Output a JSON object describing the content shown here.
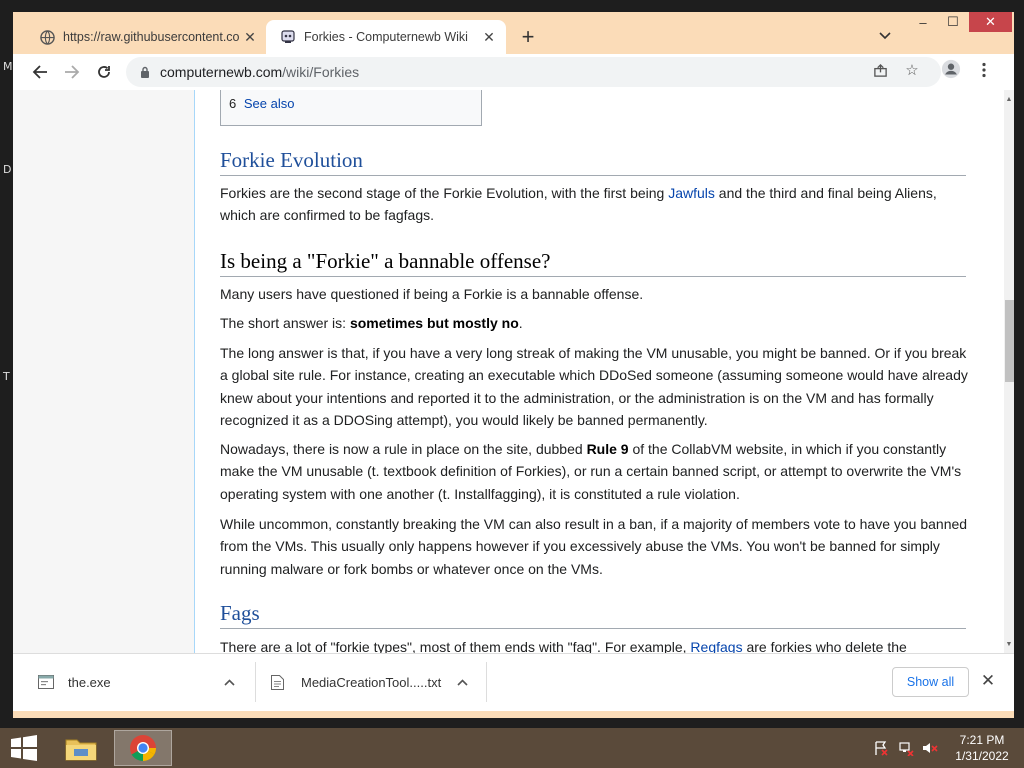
{
  "desktop": {
    "letters": [
      "M",
      "D",
      "T"
    ]
  },
  "tabs": [
    {
      "title": "https://raw.githubusercontent.co"
    },
    {
      "title": "Forkies - Computernewb Wiki"
    }
  ],
  "window": {
    "minimize": "–",
    "maximize": "☐",
    "close": "✕"
  },
  "toolbar": {
    "url_host": "computernewb.com",
    "url_path": "/wiki/Forkies"
  },
  "toc": {
    "number": "6",
    "label": "See also"
  },
  "article": {
    "h_evolution": "Forkie Evolution",
    "p_evolution_1": "Forkies are the second stage of the Forkie Evolution, with the first being ",
    "link_jawfuls": "Jawfuls",
    "p_evolution_2": " and the third and final being Aliens, which are confirmed to be fagfags.",
    "h_bannable": "Is being a \"Forkie\" a bannable offense?",
    "p_questioned": "Many users have questioned if being a Forkie is a bannable offense.",
    "p_short_1": "The short answer is: ",
    "p_short_bold": "sometimes but mostly no",
    "p_short_2": ".",
    "p_long": "The long answer is that, if you have a very long streak of making the VM unusable, you might be banned. Or if you break a global site rule. For instance, creating an executable which DDoSed someone (assuming someone would have already knew about your intentions and reported it to the administration, or the administration is on the VM and has formally recognized it as a DDOSing attempt), you would likely be banned permanently.",
    "p_nowadays_1": "Nowadays, there is now a rule in place on the site, dubbed ",
    "p_nowadays_bold": "Rule 9",
    "p_nowadays_2": " of the CollabVM website, in which if you constantly make the VM unusable (t. textbook definition of Forkies), or run a certain banned script, or attempt to overwrite the VM's operating system with one another (t. Installfagging), it is constituted a rule violation.",
    "p_uncommon": "While uncommon, constantly breaking the VM can also result in a ban, if a majority of members vote to have you banned from the VMs. This usually only happens however if you excessively abuse the VMs. You won't be banned for simply running malware or fork bombs or whatever once on the VMs.",
    "h_fags": "Fags",
    "p_fags_1": "There are a lot of \"forkie types\", most of them ends with \"fag\". For example, ",
    "link_regfags": "Regfags",
    "p_fags_2": " are forkies who delete the"
  },
  "downloads": {
    "items": [
      {
        "name": "the.exe"
      },
      {
        "name": "MediaCreationTool.....txt"
      }
    ],
    "show_all": "Show all"
  },
  "clock": {
    "time": "7:21 PM",
    "date": "1/31/2022"
  },
  "colors": {
    "accent_tab_bg": "#fbdcb8",
    "link": "#0645ad",
    "heading_blue": "#1f4f9a",
    "taskbar": "#5a4a3a"
  }
}
